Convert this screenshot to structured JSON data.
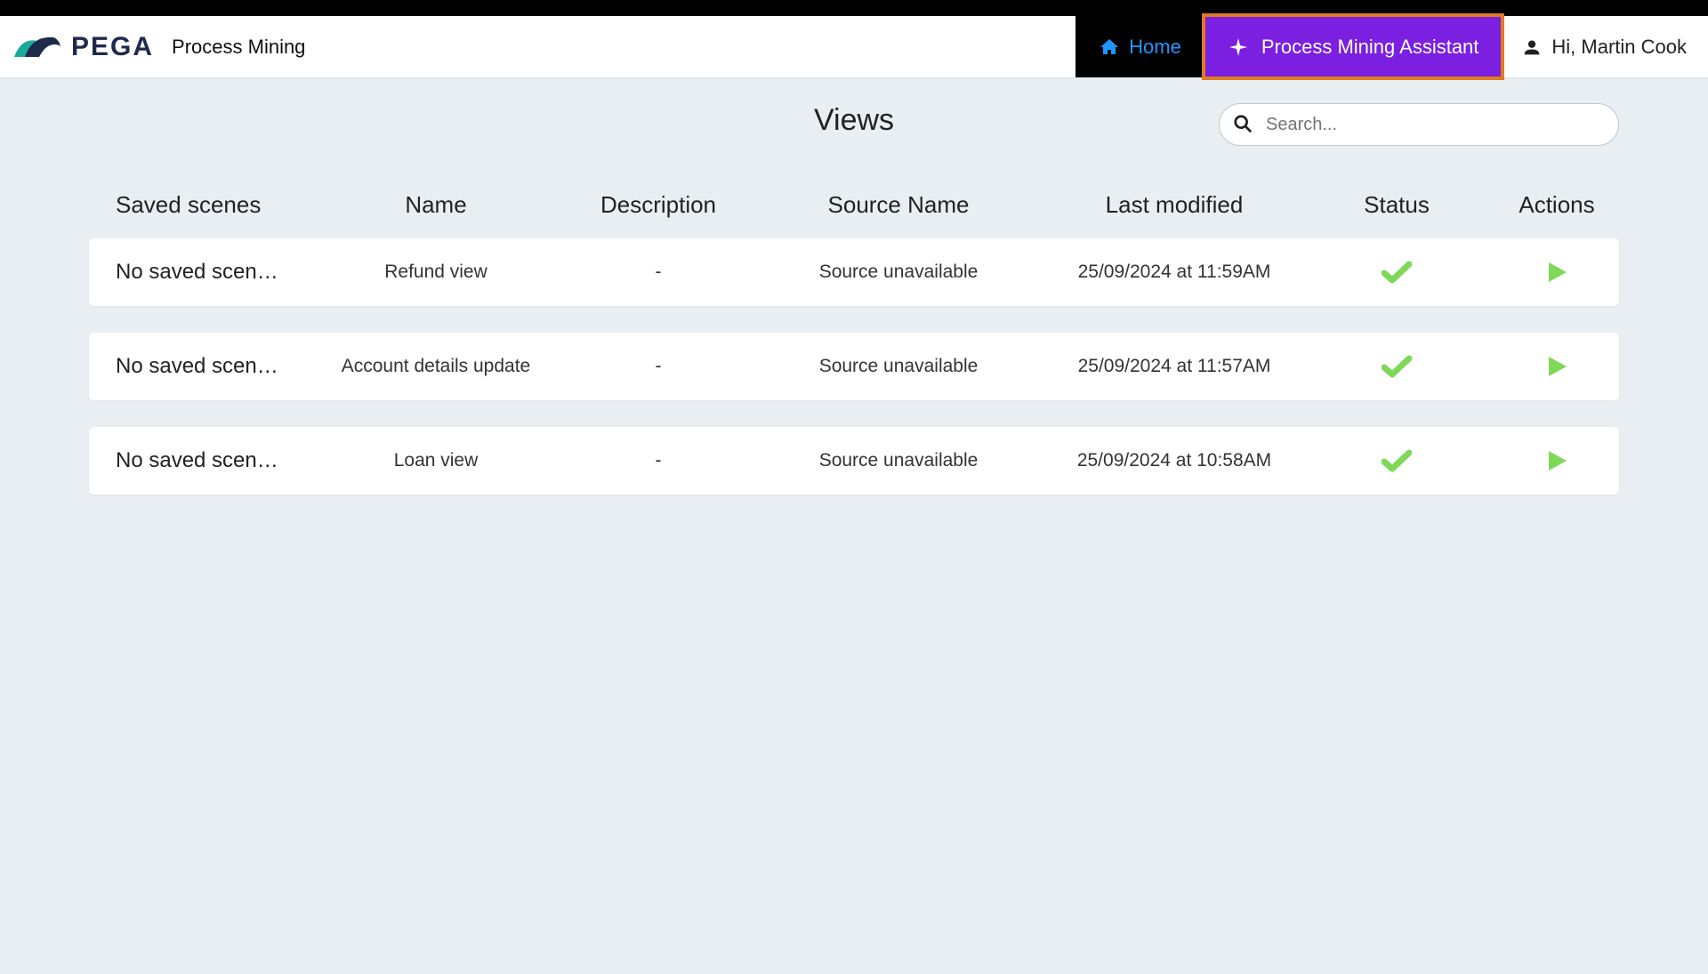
{
  "header": {
    "brand": "PEGA",
    "product": "Process Mining",
    "home_label": "Home",
    "assistant_label": "Process Mining Assistant",
    "user_greeting": "Hi, Martin Cook"
  },
  "page": {
    "title": "Views",
    "search_placeholder": "Search..."
  },
  "columns": {
    "saved_scenes": "Saved scenes",
    "name": "Name",
    "description": "Description",
    "source_name": "Source Name",
    "last_modified": "Last modified",
    "status": "Status",
    "actions": "Actions"
  },
  "rows": [
    {
      "saved_scenes": "No saved scen…",
      "name": "Refund view",
      "description": "-",
      "source_name": "Source unavailable",
      "last_modified": "25/09/2024 at 11:59AM"
    },
    {
      "saved_scenes": "No saved scen…",
      "name": "Account details update",
      "description": "-",
      "source_name": "Source unavailable",
      "last_modified": "25/09/2024 at 11:57AM"
    },
    {
      "saved_scenes": "No saved scen…",
      "name": "Loan view",
      "description": "-",
      "source_name": "Source unavailable",
      "last_modified": "25/09/2024 at 10:58AM"
    }
  ],
  "colors": {
    "accent_purple": "#7b1fe0",
    "highlight_orange": "#e07b1f",
    "link_blue": "#1e96ff",
    "status_green": "#7ed957"
  }
}
